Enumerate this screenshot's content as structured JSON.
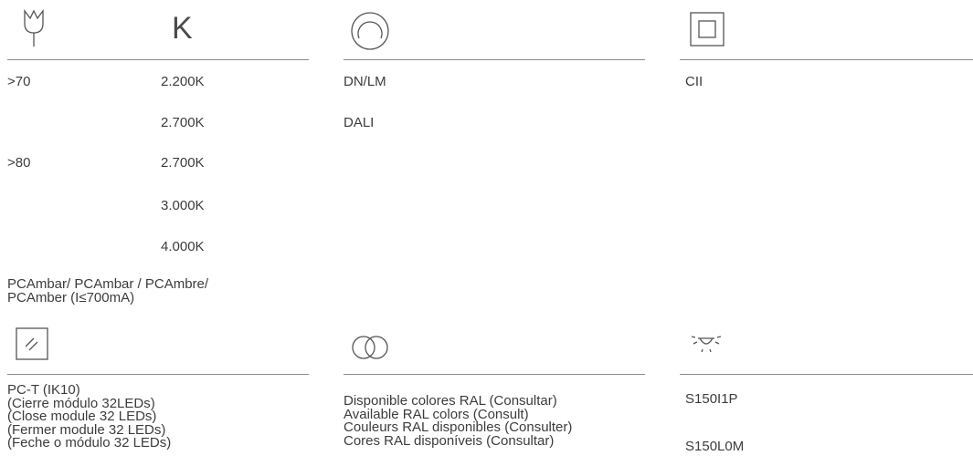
{
  "section1": {
    "k_symbol": "K",
    "cri_values": [
      ">70",
      ">80"
    ],
    "temps": [
      "2.200K",
      "2.700K",
      "2.700K",
      "3.000K",
      "4.000K"
    ],
    "note_lines": [
      "PCAmbar/ PCAmbar / PCAmbre/",
      "PCAmber (I≤700mA)"
    ]
  },
  "section2": {
    "items": [
      "DN/LM",
      "DALI"
    ]
  },
  "section3": {
    "items": [
      "CII"
    ]
  },
  "section4": {
    "lines": [
      "PC-T (IK10)",
      "(Cierre módulo 32LEDs)",
      "(Close module 32 LEDs)",
      "(Fermer module 32 LEDs)",
      "(Feche o módulo 32 LEDs)"
    ]
  },
  "section5": {
    "lines": [
      "Disponible colores RAL (Consultar)",
      "Available RAL colors (Consult)",
      "Couleurs RAL disponibles (Consulter)",
      "Cores RAL disponíveis (Consultar)"
    ]
  },
  "section6": {
    "items": [
      "S150I1P",
      "S150L0M"
    ]
  },
  "icons": {
    "cri": "flower-icon",
    "temp": "kelvin-icon",
    "control": "circle-icon",
    "class": "double-insulation-icon",
    "diffuser": "diffuser-icon",
    "color": "ral-rings-icon",
    "light": "light-source-icon"
  },
  "colors": {
    "text": "#3c3c3c",
    "rule": "#8a8a8a"
  }
}
